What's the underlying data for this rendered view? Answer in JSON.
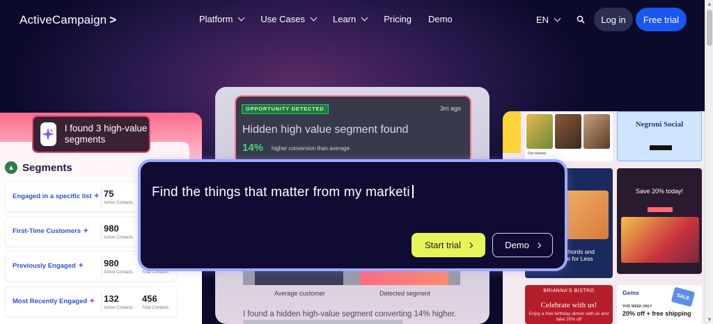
{
  "header": {
    "logo": "ActiveCampaign",
    "logo_chevron": ">",
    "nav": [
      "Platform",
      "Use Cases",
      "Learn",
      "Pricing",
      "Demo"
    ],
    "language": "EN",
    "login": "Log in",
    "free_trial": "Free trial"
  },
  "left_card": {
    "found_text": "I found 3 high-value segments",
    "segments_title": "Segments",
    "segments": [
      {
        "name": "Engaged in a specific list",
        "active": "75",
        "active_label": "Active Contacts",
        "total": "",
        "total_label": ""
      },
      {
        "name": "First-Time Customers",
        "active": "980",
        "active_label": "Active Contacts",
        "total": "",
        "total_label": ""
      },
      {
        "name": "Previously Engaged",
        "active": "980",
        "active_label": "Active Contacts",
        "total": "",
        "total_label": "Total Contacts"
      },
      {
        "name": "Most Recently Engaged",
        "active": "132",
        "active_label": "Active Contacts",
        "total": "456",
        "total_label": "Total Contacts"
      }
    ]
  },
  "center_card": {
    "badge": "OPPORTUNITY DETECTED",
    "time": "3m ago",
    "title": "Hidden high value segment found",
    "percent": "14%",
    "percent_text": "higher conversion than average",
    "avg_label": "Average customer",
    "detected_label": "Detected segment",
    "insight": "I found a hidden high-value segment converting 14% higher."
  },
  "prompt": {
    "text": "Find the things that matter from my marketi",
    "start_trial": "Start trial",
    "demo": "Demo"
  },
  "mosaic": {
    "food_chips": "Our classes",
    "negroni_title": "Negroni Social",
    "guitar_text": "Chords and\nce for Less",
    "save_title": "Save 20% today!",
    "bistro_name": "BRIANNA'S BISTRO",
    "bistro_title": "Celebrate with us!",
    "bistro_sub": "Enjoy a free birthday dinner with us and take 20% off",
    "gems_title": "Gems",
    "gems_label": "THIS WEEK ONLY",
    "gems_offer": "20% off + free shipping",
    "gems_sale": "SALE"
  }
}
